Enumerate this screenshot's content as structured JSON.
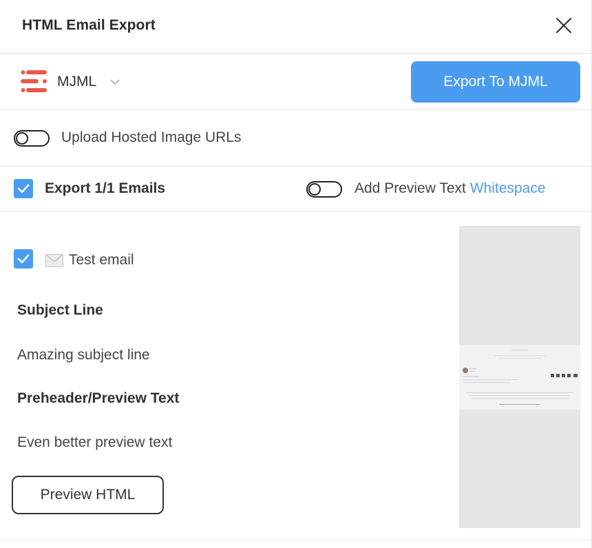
{
  "header": {
    "title": "HTML Email Export"
  },
  "format": {
    "selected": "MJML",
    "export_button_label": "Export To MJML"
  },
  "upload": {
    "label": "Upload Hosted Image URLs",
    "enabled": false
  },
  "export": {
    "count_label": "Export 1/1 Emails",
    "checked": true
  },
  "preview_whitespace": {
    "label": "Add Preview Text",
    "link": "Whitespace",
    "enabled": false
  },
  "email": {
    "checked": true,
    "icon": "envelope-icon",
    "name": "Test email",
    "subject_heading": "Subject Line",
    "subject_value": "Amazing subject line",
    "preheader_heading": "Preheader/Preview Text",
    "preheader_value": "Even better preview text",
    "preview_button_label": "Preview HTML"
  },
  "colors": {
    "accent": "#4a9cf0",
    "logo": "#e8594a",
    "thumbnail_bg": "#e6e6e6"
  }
}
